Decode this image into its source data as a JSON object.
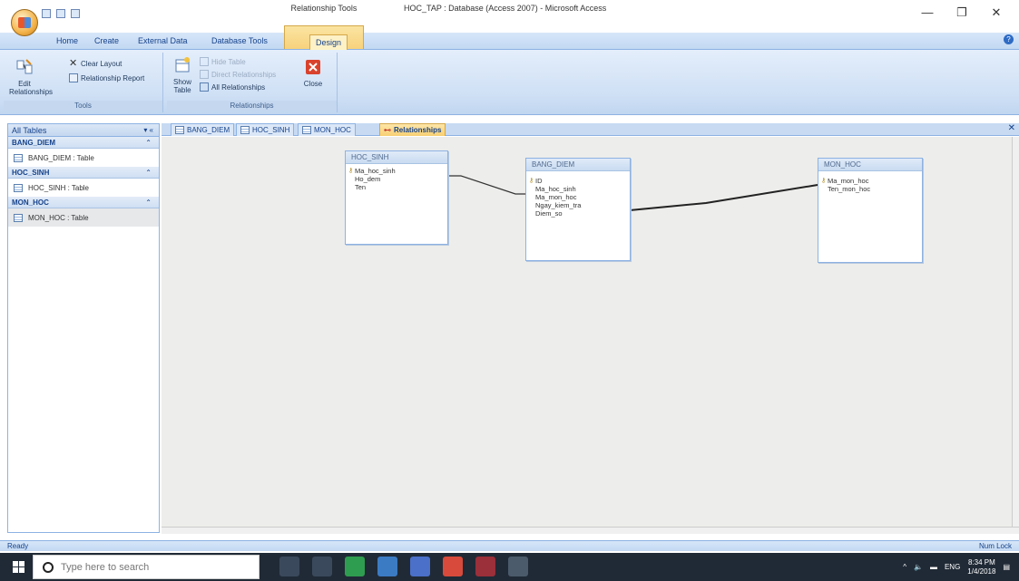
{
  "titlebar": {
    "contextual_tab_group": "Relationship Tools",
    "window_title": "HOC_TAP : Database (Access 2007) - Microsoft Access",
    "minimize": "—",
    "maximize": "❐",
    "close": "✕"
  },
  "tabs": [
    "Home",
    "Create",
    "External Data",
    "Database Tools",
    "Design"
  ],
  "ribbon": {
    "tools_group": {
      "label": "Tools",
      "edit_relationships": "Edit Relationships",
      "clear_layout": "Clear Layout",
      "relationship_report": "Relationship Report"
    },
    "relationships_group": {
      "label": "Relationships",
      "show_table": "Show Table",
      "hide_table": "Hide Table",
      "direct_relationships": "Direct Relationships",
      "all_relationships": "All Relationships",
      "close": "Close"
    }
  },
  "nav": {
    "header": "All Tables",
    "header_ctrls": "▾ «",
    "groups": [
      {
        "name": "BANG_DIEM",
        "item": "BANG_DIEM : Table"
      },
      {
        "name": "HOC_SINH",
        "item": "HOC_SINH : Table"
      },
      {
        "name": "MON_HOC",
        "item": "MON_HOC : Table"
      }
    ]
  },
  "doc_tabs": [
    "BANG_DIEM",
    "HOC_SINH",
    "MON_HOC",
    "Relationships"
  ],
  "tables": {
    "hoc_sinh": {
      "title": "HOC_SINH",
      "fields": [
        "Ma_hoc_sinh",
        "Ho_dem",
        "Ten"
      ]
    },
    "bang_diem": {
      "title": "BANG_DIEM",
      "fields": [
        "ID",
        "Ma_hoc_sinh",
        "Ma_mon_hoc",
        "Ngay_kiem_tra",
        "Diem_so"
      ]
    },
    "mon_hoc": {
      "title": "MON_HOC",
      "fields": [
        "Ma_mon_hoc",
        "Ten_mon_hoc"
      ]
    }
  },
  "status": {
    "left": "Ready",
    "right": "Num Lock"
  },
  "taskbar": {
    "search_placeholder": "Type here to search",
    "tray_lang": "ENG",
    "time": "8:34 PM",
    "date": "1/4/2018"
  },
  "colors": {
    "ribbon_blue": "#c1d6f0",
    "contextual_yellow": "#f8cf72",
    "taskbar": "#202a36"
  }
}
